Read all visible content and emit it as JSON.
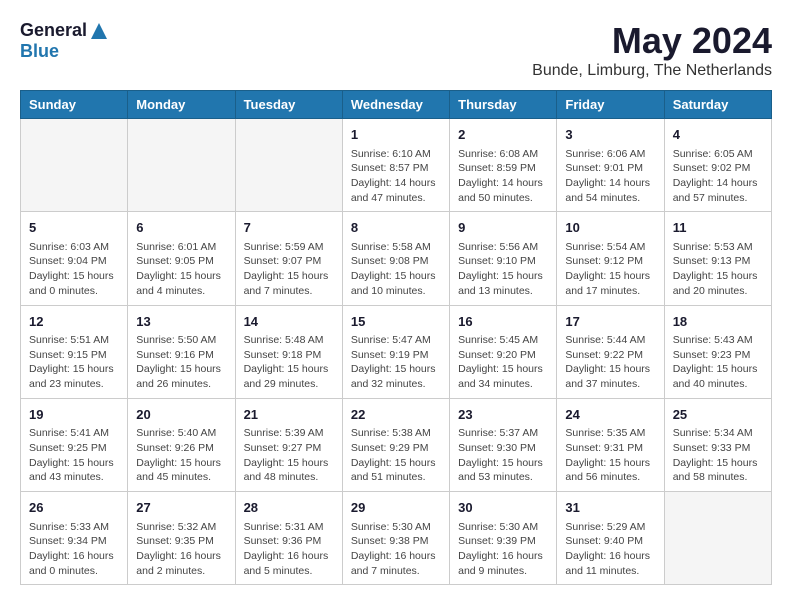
{
  "logo": {
    "general": "General",
    "blue": "Blue"
  },
  "title": "May 2024",
  "location": "Bunde, Limburg, The Netherlands",
  "days_of_week": [
    "Sunday",
    "Monday",
    "Tuesday",
    "Wednesday",
    "Thursday",
    "Friday",
    "Saturday"
  ],
  "weeks": [
    [
      {
        "day": "",
        "content": ""
      },
      {
        "day": "",
        "content": ""
      },
      {
        "day": "",
        "content": ""
      },
      {
        "day": "1",
        "content": "Sunrise: 6:10 AM\nSunset: 8:57 PM\nDaylight: 14 hours\nand 47 minutes."
      },
      {
        "day": "2",
        "content": "Sunrise: 6:08 AM\nSunset: 8:59 PM\nDaylight: 14 hours\nand 50 minutes."
      },
      {
        "day": "3",
        "content": "Sunrise: 6:06 AM\nSunset: 9:01 PM\nDaylight: 14 hours\nand 54 minutes."
      },
      {
        "day": "4",
        "content": "Sunrise: 6:05 AM\nSunset: 9:02 PM\nDaylight: 14 hours\nand 57 minutes."
      }
    ],
    [
      {
        "day": "5",
        "content": "Sunrise: 6:03 AM\nSunset: 9:04 PM\nDaylight: 15 hours\nand 0 minutes."
      },
      {
        "day": "6",
        "content": "Sunrise: 6:01 AM\nSunset: 9:05 PM\nDaylight: 15 hours\nand 4 minutes."
      },
      {
        "day": "7",
        "content": "Sunrise: 5:59 AM\nSunset: 9:07 PM\nDaylight: 15 hours\nand 7 minutes."
      },
      {
        "day": "8",
        "content": "Sunrise: 5:58 AM\nSunset: 9:08 PM\nDaylight: 15 hours\nand 10 minutes."
      },
      {
        "day": "9",
        "content": "Sunrise: 5:56 AM\nSunset: 9:10 PM\nDaylight: 15 hours\nand 13 minutes."
      },
      {
        "day": "10",
        "content": "Sunrise: 5:54 AM\nSunset: 9:12 PM\nDaylight: 15 hours\nand 17 minutes."
      },
      {
        "day": "11",
        "content": "Sunrise: 5:53 AM\nSunset: 9:13 PM\nDaylight: 15 hours\nand 20 minutes."
      }
    ],
    [
      {
        "day": "12",
        "content": "Sunrise: 5:51 AM\nSunset: 9:15 PM\nDaylight: 15 hours\nand 23 minutes."
      },
      {
        "day": "13",
        "content": "Sunrise: 5:50 AM\nSunset: 9:16 PM\nDaylight: 15 hours\nand 26 minutes."
      },
      {
        "day": "14",
        "content": "Sunrise: 5:48 AM\nSunset: 9:18 PM\nDaylight: 15 hours\nand 29 minutes."
      },
      {
        "day": "15",
        "content": "Sunrise: 5:47 AM\nSunset: 9:19 PM\nDaylight: 15 hours\nand 32 minutes."
      },
      {
        "day": "16",
        "content": "Sunrise: 5:45 AM\nSunset: 9:20 PM\nDaylight: 15 hours\nand 34 minutes."
      },
      {
        "day": "17",
        "content": "Sunrise: 5:44 AM\nSunset: 9:22 PM\nDaylight: 15 hours\nand 37 minutes."
      },
      {
        "day": "18",
        "content": "Sunrise: 5:43 AM\nSunset: 9:23 PM\nDaylight: 15 hours\nand 40 minutes."
      }
    ],
    [
      {
        "day": "19",
        "content": "Sunrise: 5:41 AM\nSunset: 9:25 PM\nDaylight: 15 hours\nand 43 minutes."
      },
      {
        "day": "20",
        "content": "Sunrise: 5:40 AM\nSunset: 9:26 PM\nDaylight: 15 hours\nand 45 minutes."
      },
      {
        "day": "21",
        "content": "Sunrise: 5:39 AM\nSunset: 9:27 PM\nDaylight: 15 hours\nand 48 minutes."
      },
      {
        "day": "22",
        "content": "Sunrise: 5:38 AM\nSunset: 9:29 PM\nDaylight: 15 hours\nand 51 minutes."
      },
      {
        "day": "23",
        "content": "Sunrise: 5:37 AM\nSunset: 9:30 PM\nDaylight: 15 hours\nand 53 minutes."
      },
      {
        "day": "24",
        "content": "Sunrise: 5:35 AM\nSunset: 9:31 PM\nDaylight: 15 hours\nand 56 minutes."
      },
      {
        "day": "25",
        "content": "Sunrise: 5:34 AM\nSunset: 9:33 PM\nDaylight: 15 hours\nand 58 minutes."
      }
    ],
    [
      {
        "day": "26",
        "content": "Sunrise: 5:33 AM\nSunset: 9:34 PM\nDaylight: 16 hours\nand 0 minutes."
      },
      {
        "day": "27",
        "content": "Sunrise: 5:32 AM\nSunset: 9:35 PM\nDaylight: 16 hours\nand 2 minutes."
      },
      {
        "day": "28",
        "content": "Sunrise: 5:31 AM\nSunset: 9:36 PM\nDaylight: 16 hours\nand 5 minutes."
      },
      {
        "day": "29",
        "content": "Sunrise: 5:30 AM\nSunset: 9:38 PM\nDaylight: 16 hours\nand 7 minutes."
      },
      {
        "day": "30",
        "content": "Sunrise: 5:30 AM\nSunset: 9:39 PM\nDaylight: 16 hours\nand 9 minutes."
      },
      {
        "day": "31",
        "content": "Sunrise: 5:29 AM\nSunset: 9:40 PM\nDaylight: 16 hours\nand 11 minutes."
      },
      {
        "day": "",
        "content": ""
      }
    ]
  ]
}
